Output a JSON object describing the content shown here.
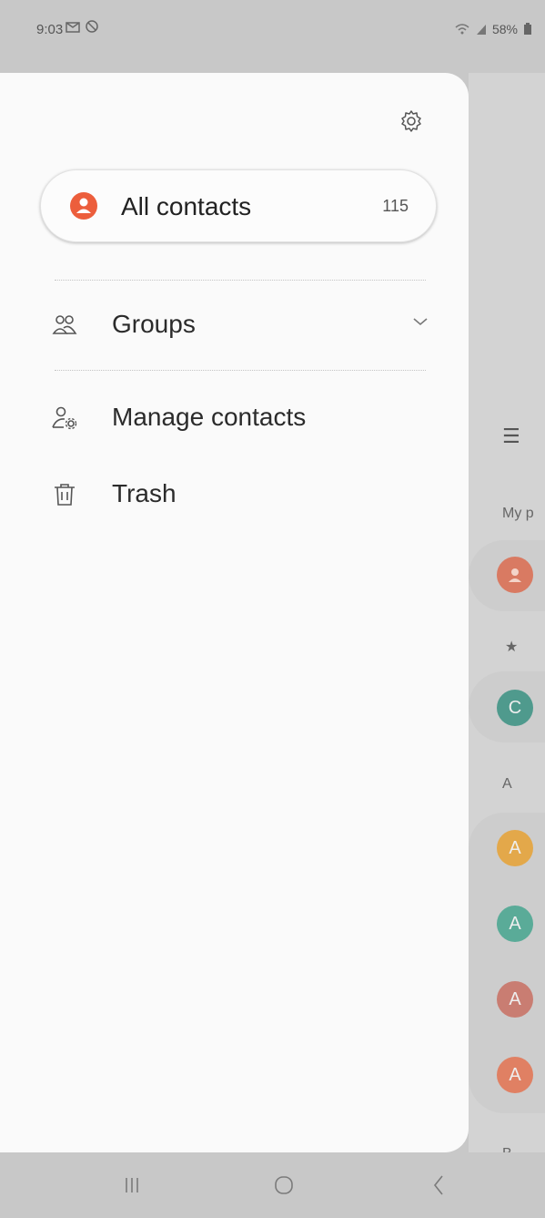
{
  "status_bar": {
    "time": "9:03",
    "battery": "58%"
  },
  "drawer": {
    "all_contacts": {
      "label": "All contacts",
      "count": "115"
    },
    "groups_label": "Groups",
    "manage_label": "Manage contacts",
    "trash_label": "Trash"
  },
  "background_list": {
    "section_my_profile": "My p",
    "section_a": "A",
    "section_b": "B",
    "avatars": [
      {
        "letter": "",
        "color": "#d97a62"
      },
      {
        "letter": "C",
        "color": "#4f9a8d"
      },
      {
        "letter": "A",
        "color": "#e3a84a"
      },
      {
        "letter": "A",
        "color": "#5aab98"
      },
      {
        "letter": "A",
        "color": "#c97d72"
      },
      {
        "letter": "A",
        "color": "#e08063"
      }
    ]
  },
  "colors": {
    "accent": "#ec5e3c",
    "drawer_bg": "#fafafa",
    "scrim": "#c8c8c8"
  }
}
